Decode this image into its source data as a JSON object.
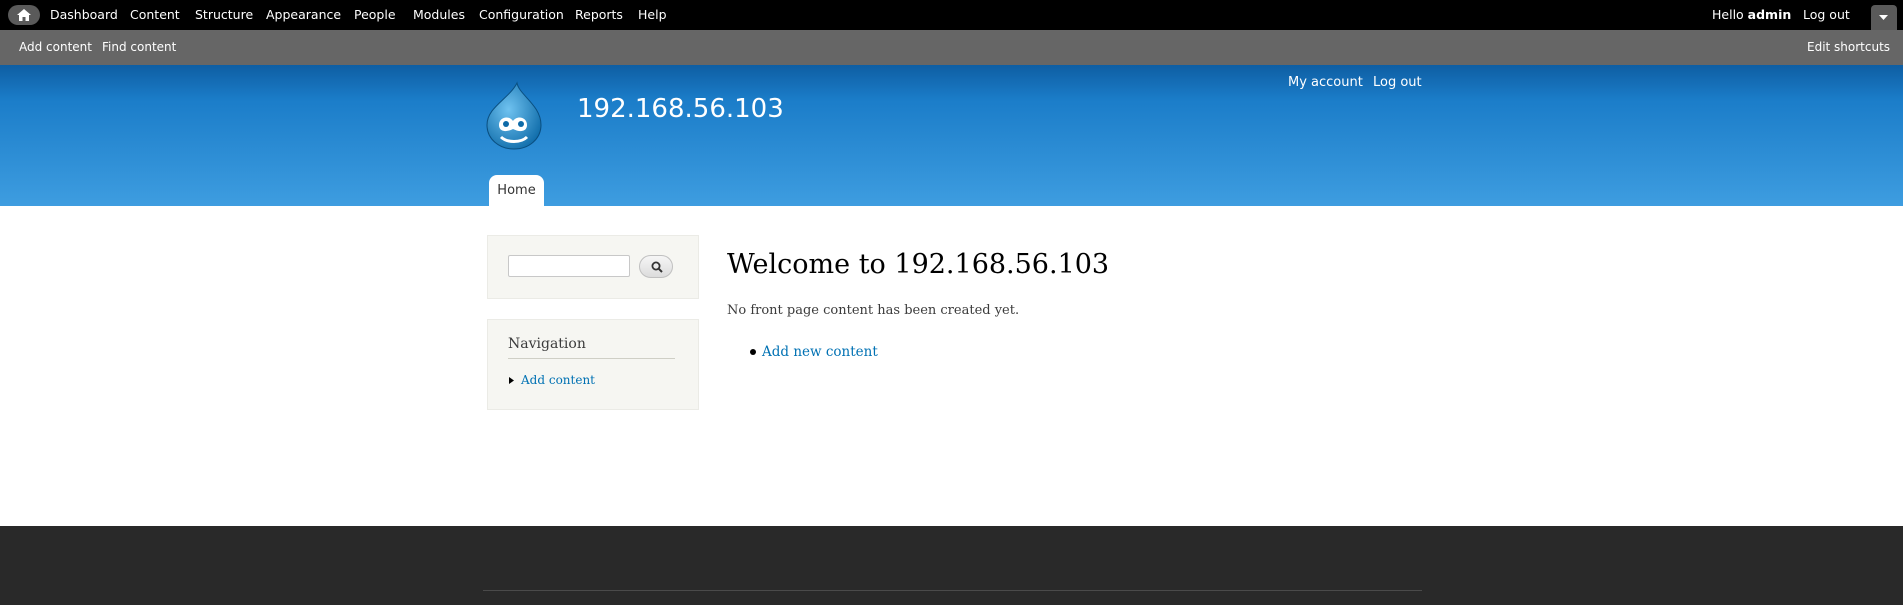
{
  "admin_toolbar": {
    "home_icon": "home-icon",
    "menu": [
      {
        "label": "Dashboard"
      },
      {
        "label": "Content"
      },
      {
        "label": "Structure"
      },
      {
        "label": "Appearance"
      },
      {
        "label": "People"
      },
      {
        "label": "Modules"
      },
      {
        "label": "Configuration"
      },
      {
        "label": "Reports"
      },
      {
        "label": "Help"
      }
    ],
    "hello_label": "Hello",
    "username": "admin",
    "logout_label": "Log out",
    "drawer_toggle_icon": "chevron-down-icon"
  },
  "shortcuts": {
    "items": [
      {
        "label": "Add content"
      },
      {
        "label": "Find content"
      }
    ],
    "edit_label": "Edit shortcuts"
  },
  "header": {
    "site_name": "192.168.56.103",
    "logo_icon": "drupal-drop-logo",
    "secondary_menu": [
      {
        "label": "My account"
      },
      {
        "label": "Log out"
      }
    ],
    "main_menu": [
      {
        "label": "Home"
      }
    ]
  },
  "sidebar": {
    "search": {
      "input_value": "",
      "button_icon": "search-icon"
    },
    "navigation": {
      "title": "Navigation",
      "items": [
        {
          "label": "Add content"
        }
      ]
    }
  },
  "main": {
    "title": "Welcome to 192.168.56.103",
    "message": "No front page content has been created yet.",
    "links": [
      {
        "label": "Add new content"
      }
    ]
  },
  "colors": {
    "toolbar_bg": "#000000",
    "shortcuts_bg": "#666666",
    "header_top": "#0e5ea3",
    "header_bottom": "#3e9de0",
    "link": "#0071b3",
    "footer_bg": "#292929"
  }
}
